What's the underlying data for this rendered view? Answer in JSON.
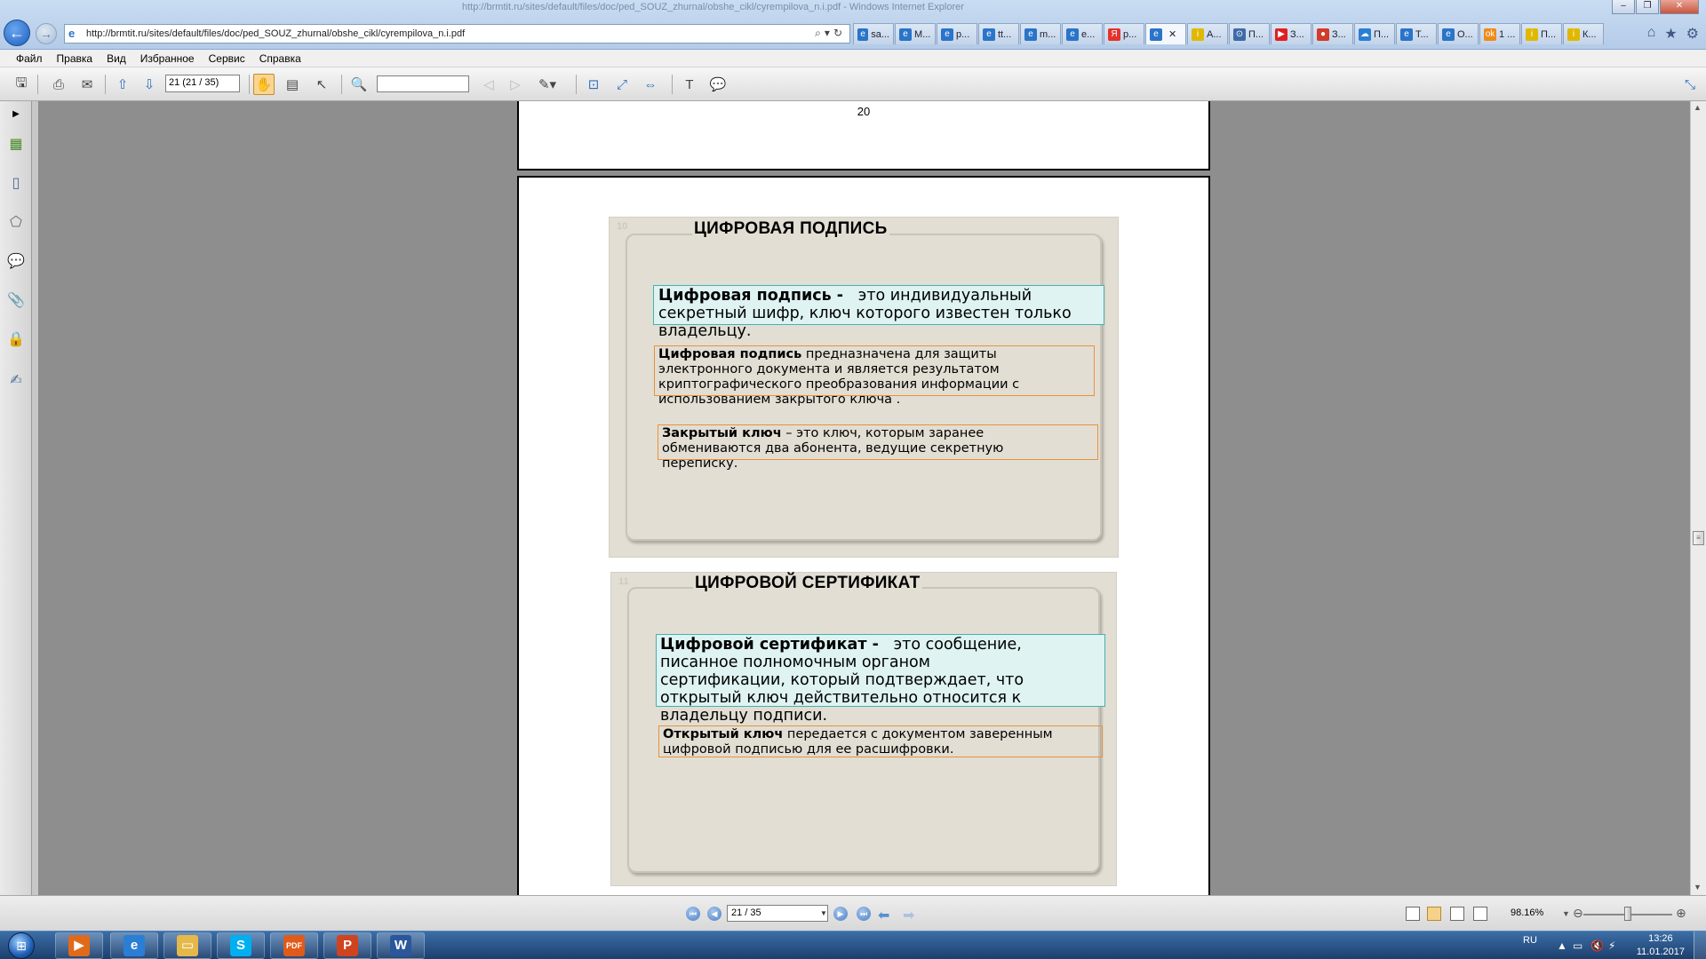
{
  "browser": {
    "window_title": "http://brmtit.ru/sites/default/files/doc/ped_SOUZ_zhurnal/obshe_cikl/cyrempilova_n.i.pdf - Windows Internet Explorer",
    "url": "http://brmtit.ru/sites/default/files/doc/ped_SOUZ_zhurnal/obshe_cikl/cyrempilova_n.i.pdf",
    "tabs": [
      {
        "label": "sa...",
        "icon": "ie-icon",
        "color": "#2a74c9"
      },
      {
        "label": "M...",
        "icon": "ie-icon",
        "color": "#2a74c9"
      },
      {
        "label": "p...",
        "icon": "ie-icon",
        "color": "#2a74c9"
      },
      {
        "label": "tt...",
        "icon": "ie-icon",
        "color": "#2a74c9"
      },
      {
        "label": "m...",
        "icon": "ie-icon",
        "color": "#2a74c9"
      },
      {
        "label": "e...",
        "icon": "ie-icon",
        "color": "#2a74c9"
      },
      {
        "label": "p...",
        "icon": "yandex-icon",
        "color": "#e4322c"
      },
      {
        "label": "",
        "icon": "ie-icon",
        "color": "#2a74c9",
        "active": true
      },
      {
        "label": "A...",
        "icon": "info-icon",
        "color": "#e0b800"
      },
      {
        "label": "П...",
        "icon": "compass-icon",
        "color": "#3e6aa8"
      },
      {
        "label": "З...",
        "icon": "youtube-icon",
        "color": "#e02020"
      },
      {
        "label": "З...",
        "icon": "camera-icon",
        "color": "#d23a2a"
      },
      {
        "label": "П...",
        "icon": "cloud-icon",
        "color": "#2a7fd4"
      },
      {
        "label": "Т...",
        "icon": "ie-icon",
        "color": "#2a74c9"
      },
      {
        "label": "О...",
        "icon": "ie-icon",
        "color": "#2a74c9"
      },
      {
        "label": "1 ...",
        "icon": "ok-icon",
        "color": "#ef8a17"
      },
      {
        "label": "П...",
        "icon": "info-icon",
        "color": "#e0b800"
      },
      {
        "label": "К...",
        "icon": "info-icon",
        "color": "#e0b800"
      }
    ]
  },
  "menu": [
    "Файл",
    "Правка",
    "Вид",
    "Избранное",
    "Сервис",
    "Справка"
  ],
  "toolbar": {
    "page_field": "21 (21 / 35)",
    "find_field": ""
  },
  "document": {
    "prev_page_number": "20",
    "slide1": {
      "number": "10",
      "title": "ЦИФРОВАЯ ПОДПИСЬ",
      "p1_bold": "Цифровая подпись -",
      "p1_rest_line1": "это индивидуальный",
      "p1_line2": "секретный шифр, ключ которого известен только",
      "p1_line3": "владельцу.",
      "p2_bold": "Цифровая подпись",
      "p2_rest_line1": "предназначена для защиты",
      "p2_line2": "электронного документа и является результатом",
      "p2_line3": "криптографического преобразования информации с",
      "p2_line4": "использованием закрытого ключа .",
      "p3_bold": "Закрытый ключ",
      "p3_rest_line1": "– это ключ, которым заранее",
      "p3_line2": "обмениваются два абонента, ведущие секретную",
      "p3_line3": "переписку."
    },
    "slide2": {
      "number": "11",
      "title": "ЦИФРОВОЙ СЕРТИФИКАТ",
      "p1_bold": "Цифровой сертификат -",
      "p1_rest_line1": "это сообщение,",
      "p1_line2": "писанное полномочным органом",
      "p1_line3": "сертификации, который подтверждает, что",
      "p1_line4": "открытый ключ действительно относится к",
      "p1_line5": "владельцу подписи.",
      "p2_bold": "Открытый ключ",
      "p2_rest_line1": "передается с документом заверенным",
      "p2_line2": "цифровой подписью для ее расшифровки."
    }
  },
  "statusbar": {
    "page_field": "21 / 35",
    "zoom": "98.16%"
  },
  "taskbar": {
    "apps": [
      {
        "name": "media-player",
        "glyph": "▶",
        "color": "#e06a1a"
      },
      {
        "name": "internet-explorer",
        "glyph": "e",
        "color": "#2a7fd4"
      },
      {
        "name": "file-explorer",
        "glyph": "▭",
        "color": "#e5b84a"
      },
      {
        "name": "skype",
        "glyph": "S",
        "color": "#00aff0"
      },
      {
        "name": "pdf-reader",
        "glyph": "PDF",
        "color": "#e05a1a"
      },
      {
        "name": "powerpoint",
        "glyph": "P",
        "color": "#d0431f"
      },
      {
        "name": "word",
        "glyph": "W",
        "color": "#2b579a"
      }
    ],
    "language": "RU",
    "time": "13:26",
    "date": "11.01.2017"
  }
}
